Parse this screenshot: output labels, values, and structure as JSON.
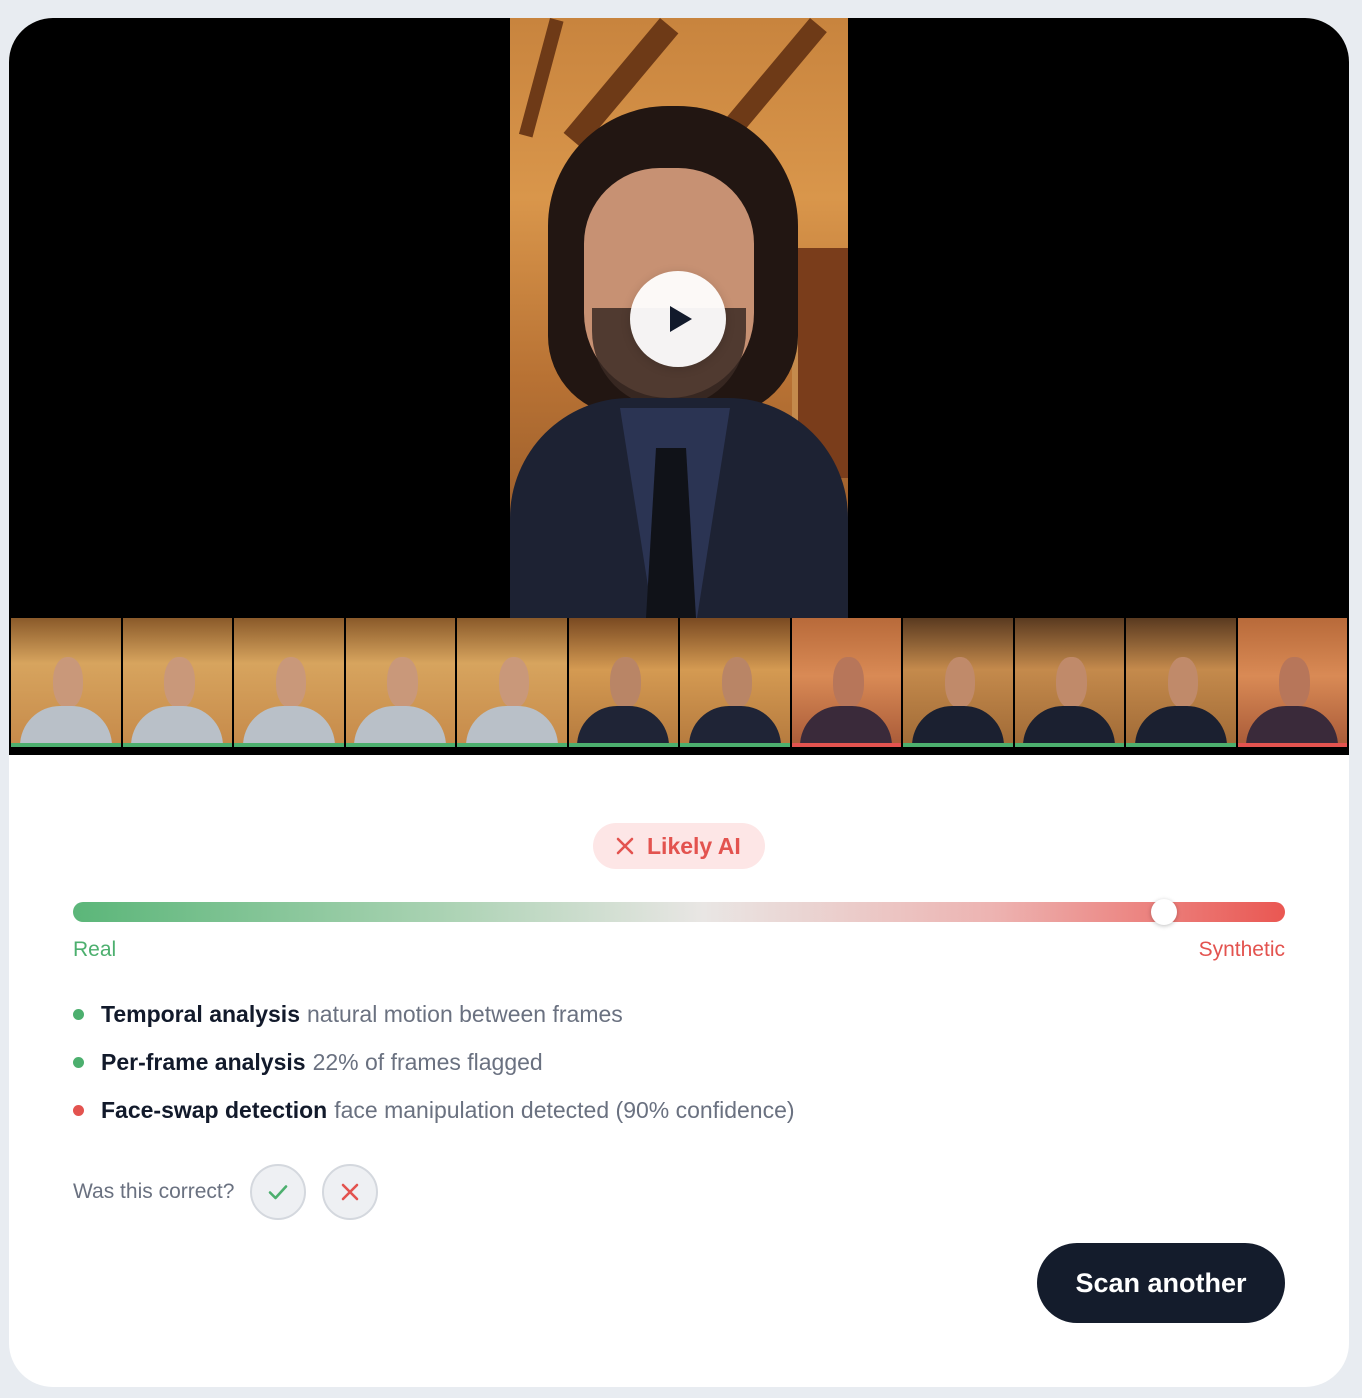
{
  "video": {
    "play_icon": "play-icon",
    "frames": [
      {
        "scene": "man-hoodie",
        "status": "real"
      },
      {
        "scene": "man-hoodie",
        "status": "real"
      },
      {
        "scene": "man-hoodie",
        "status": "real"
      },
      {
        "scene": "man-hoodie",
        "status": "real"
      },
      {
        "scene": "man-hoodie",
        "status": "real"
      },
      {
        "scene": "man-suit",
        "status": "real"
      },
      {
        "scene": "man-suit",
        "status": "real"
      },
      {
        "scene": "man-suit-warm",
        "status": "flagged"
      },
      {
        "scene": "man-suit-close",
        "status": "real"
      },
      {
        "scene": "man-suit-close",
        "status": "real"
      },
      {
        "scene": "man-suit-close",
        "status": "real"
      },
      {
        "scene": "man-suit-warm",
        "status": "flagged"
      }
    ]
  },
  "verdict": {
    "label": "Likely AI",
    "icon": "x-icon",
    "color": "#e3534f",
    "background": "#fde6e6"
  },
  "scale": {
    "left_label": "Real",
    "right_label": "Synthetic",
    "score": 0.9,
    "real_color": "#4caf6e",
    "synthetic_color": "#e3534f"
  },
  "findings": [
    {
      "title": "Temporal analysis",
      "description": "natural motion between frames",
      "status": "pass",
      "color": "#4caf6e"
    },
    {
      "title": "Per-frame analysis",
      "description": "22% of frames flagged",
      "status": "pass",
      "color": "#4caf6e"
    },
    {
      "title": "Face-swap detection",
      "description": "face manipulation detected (90% confidence)",
      "status": "fail",
      "color": "#e3534f"
    }
  ],
  "feedback": {
    "prompt": "Was this correct?",
    "yes_icon": "check-icon",
    "no_icon": "x-icon"
  },
  "actions": {
    "scan_another": "Scan another"
  }
}
